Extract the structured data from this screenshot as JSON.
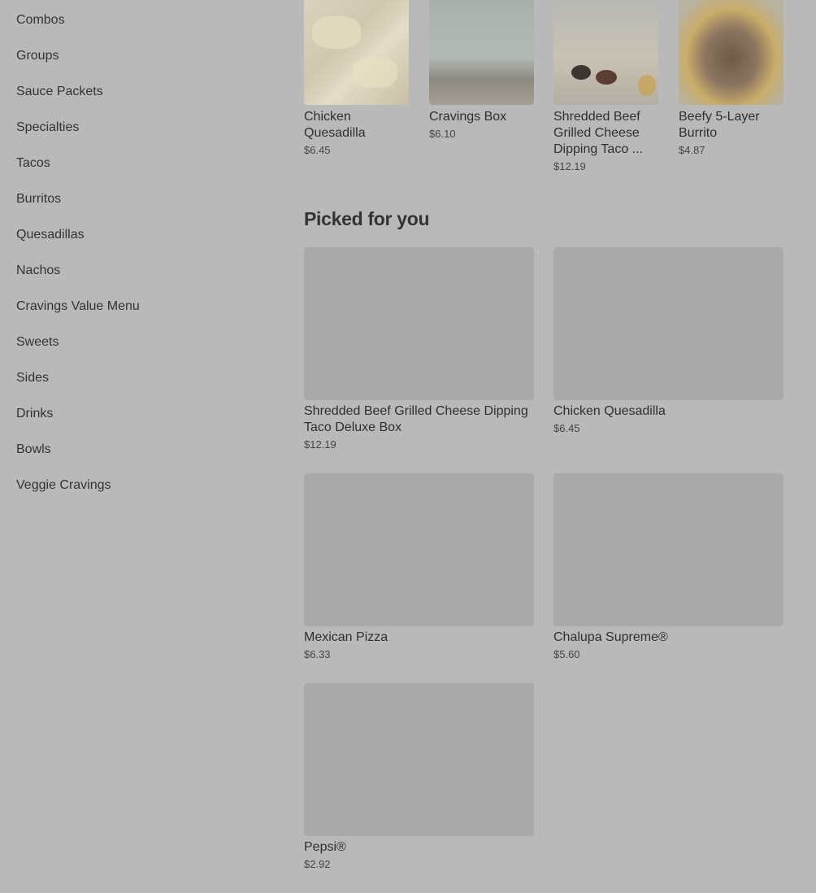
{
  "sidebar": {
    "items": [
      {
        "label": "Combos"
      },
      {
        "label": "Groups"
      },
      {
        "label": "Sauce Packets"
      },
      {
        "label": "Specialties"
      },
      {
        "label": "Tacos"
      },
      {
        "label": "Burritos"
      },
      {
        "label": "Quesadillas"
      },
      {
        "label": "Nachos"
      },
      {
        "label": "Cravings Value Menu"
      },
      {
        "label": "Sweets"
      },
      {
        "label": "Sides"
      },
      {
        "label": "Drinks"
      },
      {
        "label": "Bowls"
      },
      {
        "label": "Veggie Cravings"
      }
    ]
  },
  "top_items": [
    {
      "title": "Chicken Quesadilla",
      "price": "$6.45"
    },
    {
      "title": "Cravings Box",
      "price": "$6.10"
    },
    {
      "title": "Shredded Beef Grilled Cheese Dipping Taco ...",
      "price": "$12.19"
    },
    {
      "title": "Beefy 5-Layer Burrito",
      "price": "$4.87"
    }
  ],
  "picked": {
    "title": "Picked for you",
    "items": [
      {
        "title": "Shredded Beef Grilled Cheese Dipping Taco Deluxe Box",
        "price": "$12.19"
      },
      {
        "title": "Chicken Quesadilla",
        "price": "$6.45"
      },
      {
        "title": "Mexican Pizza",
        "price": "$6.33"
      },
      {
        "title": "Chalupa Supreme®",
        "price": "$5.60"
      },
      {
        "title": "Pepsi®",
        "price": "$2.92"
      }
    ]
  }
}
